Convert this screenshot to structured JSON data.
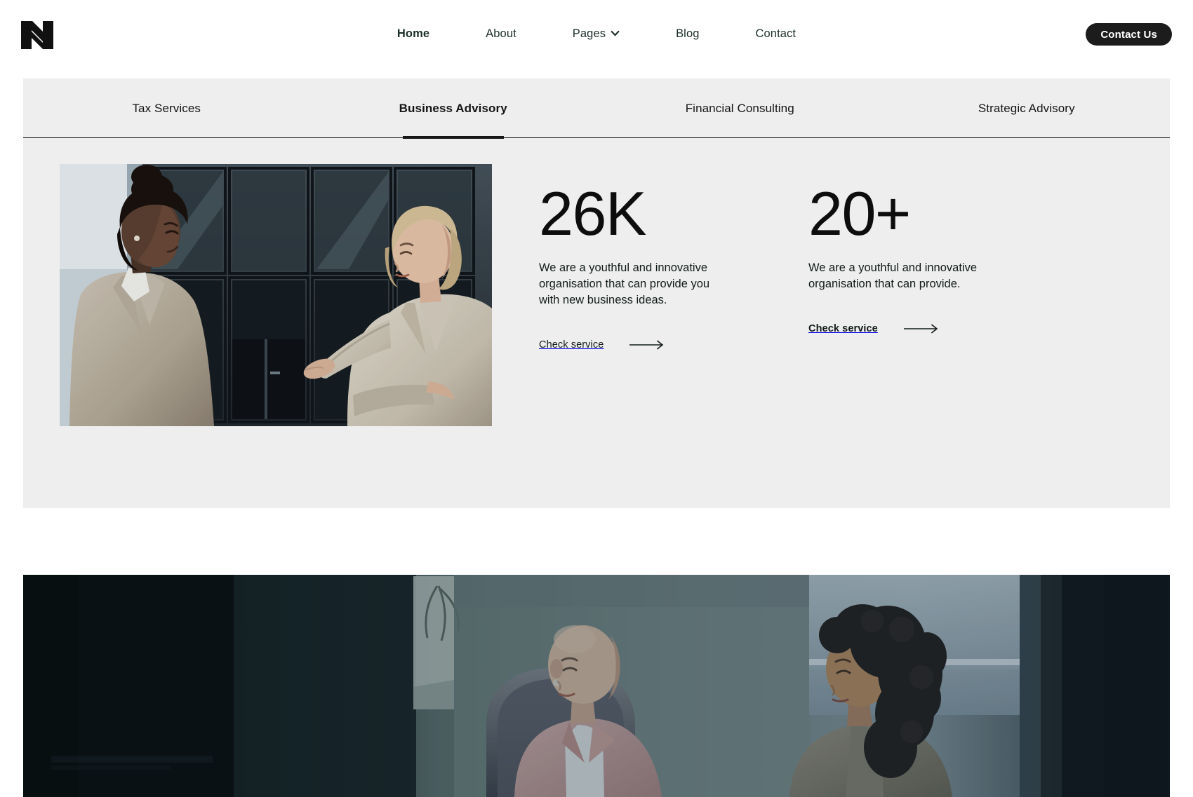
{
  "header": {
    "logo_name": "N logo mark",
    "nav": [
      {
        "label": "Home",
        "active": true,
        "has_dropdown": false
      },
      {
        "label": "About",
        "active": false,
        "has_dropdown": false
      },
      {
        "label": "Pages",
        "active": false,
        "has_dropdown": true
      },
      {
        "label": "Blog",
        "active": false,
        "has_dropdown": false
      },
      {
        "label": "Contact",
        "active": false,
        "has_dropdown": false
      }
    ],
    "cta_label": "Contact Us"
  },
  "tabs": [
    {
      "label": "Tax Services",
      "active": false
    },
    {
      "label": "Business Advisory",
      "active": true
    },
    {
      "label": "Financial Consulting",
      "active": false
    },
    {
      "label": "Strategic Advisory",
      "active": false
    }
  ],
  "feature": {
    "image_alt": "Two businesswomen in conversation outside a modern glass and steel building"
  },
  "stats": [
    {
      "number": "26K",
      "description": "We are a youthful and innovative organisation that can provide you with new business ideas.",
      "link_label": "Check service",
      "link_bold": false
    },
    {
      "number": "20+",
      "description": "We are a youthful and innovative organisation that can provide.",
      "link_label": "Check service",
      "link_bold": true
    }
  ],
  "bottom_banner": {
    "image_alt": "Two women seated in a dimly lit office meeting room in conversation"
  },
  "colors": {
    "panel_bg": "#efeeee",
    "page_bg": "#ffffff",
    "text": "#101b19",
    "accent_dark": "#1c1c1c"
  }
}
